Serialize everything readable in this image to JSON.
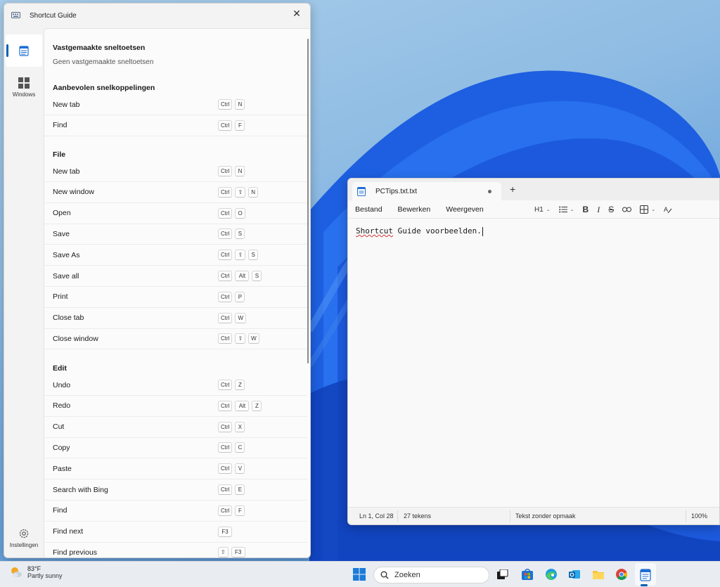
{
  "shortcut_guide": {
    "title": "Shortcut Guide",
    "rail": {
      "windows_label": "Windows",
      "settings_label": "Instellingen"
    },
    "pinned": {
      "heading": "Vastgemaakte sneltoetsen",
      "empty_text": "Geen vastgemaakte sneltoetsen"
    },
    "recommended": {
      "heading": "Aanbevolen snelkoppelingen",
      "rows": [
        {
          "label": "New tab",
          "keys": [
            "Ctrl",
            "N"
          ]
        },
        {
          "label": "Find",
          "keys": [
            "Ctrl",
            "F"
          ]
        }
      ]
    },
    "file": {
      "heading": "File",
      "rows": [
        {
          "label": "New tab",
          "keys": [
            "Ctrl",
            "N"
          ]
        },
        {
          "label": "New window",
          "keys": [
            "Ctrl",
            "⇧",
            "N"
          ]
        },
        {
          "label": "Open",
          "keys": [
            "Ctrl",
            "O"
          ]
        },
        {
          "label": "Save",
          "keys": [
            "Ctrl",
            "S"
          ]
        },
        {
          "label": "Save As",
          "keys": [
            "Ctrl",
            "⇧",
            "S"
          ]
        },
        {
          "label": "Save all",
          "keys": [
            "Ctrl",
            "Alt",
            "S"
          ]
        },
        {
          "label": "Print",
          "keys": [
            "Ctrl",
            "P"
          ]
        },
        {
          "label": "Close tab",
          "keys": [
            "Ctrl",
            "W"
          ]
        },
        {
          "label": "Close window",
          "keys": [
            "Ctrl",
            "⇧",
            "W"
          ]
        }
      ]
    },
    "edit": {
      "heading": "Edit",
      "rows": [
        {
          "label": "Undo",
          "keys": [
            "Ctrl",
            "Z"
          ]
        },
        {
          "label": "Redo",
          "keys": [
            "Ctrl",
            "Alt",
            "Z"
          ]
        },
        {
          "label": "Cut",
          "keys": [
            "Ctrl",
            "X"
          ]
        },
        {
          "label": "Copy",
          "keys": [
            "Ctrl",
            "C"
          ]
        },
        {
          "label": "Paste",
          "keys": [
            "Ctrl",
            "V"
          ]
        },
        {
          "label": "Search with Bing",
          "keys": [
            "Ctrl",
            "E"
          ]
        },
        {
          "label": "Find",
          "keys": [
            "Ctrl",
            "F"
          ]
        },
        {
          "label": "Find next",
          "keys": [
            "F3"
          ]
        },
        {
          "label": "Find previous",
          "keys": [
            "⇧",
            "F3"
          ]
        }
      ]
    }
  },
  "notepad": {
    "tab_title": "PCTips.txt.txt",
    "menus": [
      "Bestand",
      "Bewerken",
      "Weergeven"
    ],
    "heading_tool": "H1",
    "text_typo": "Shortcut",
    "text_rest": " Guide voorbeelden.",
    "status": {
      "position": "Ln 1, Col 28",
      "chars": "27 tekens",
      "format": "Tekst zonder opmaak",
      "zoom": "100%"
    }
  },
  "taskbar": {
    "weather_temp": "83°F",
    "weather_desc": "Partly sunny",
    "search_placeholder": "Zoeken"
  }
}
